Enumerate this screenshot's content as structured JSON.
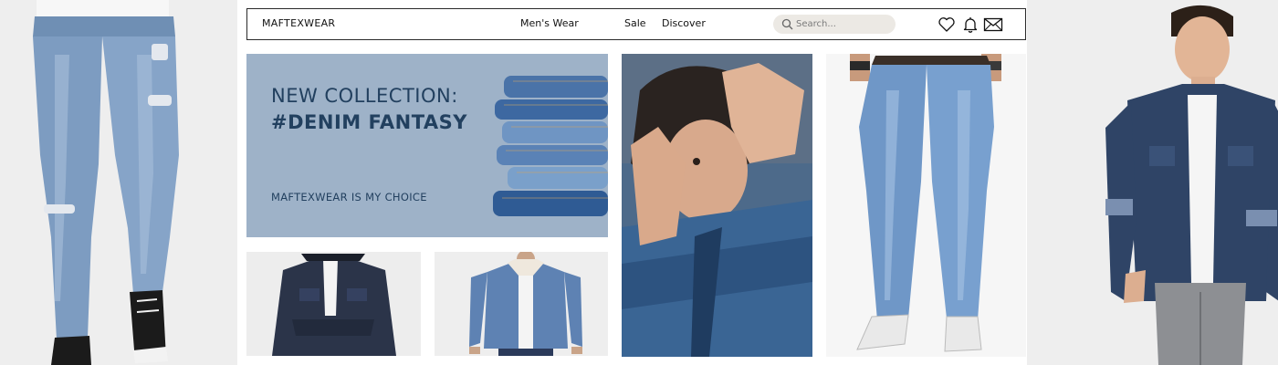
{
  "header": {
    "brand": "MAFTEXWEAR",
    "nav": [
      "Men's Wear",
      "Sale",
      "Discover"
    ],
    "search_placeholder": "Search..."
  },
  "hero": {
    "line1": "NEW COLLECTION:",
    "line2": "#DENIM FANTASY",
    "tagline": "MAFTEXWEAR IS MY CHOICE"
  },
  "icons": [
    "search-icon",
    "heart-icon",
    "bell-icon",
    "mail-icon"
  ],
  "colors": {
    "hero_bg": "#9eb2c8",
    "hero_text": "#22405f",
    "search_bg": "#ece9e4",
    "denim_dark": "#2d3e5c",
    "denim_light": "#7a9cc4"
  }
}
